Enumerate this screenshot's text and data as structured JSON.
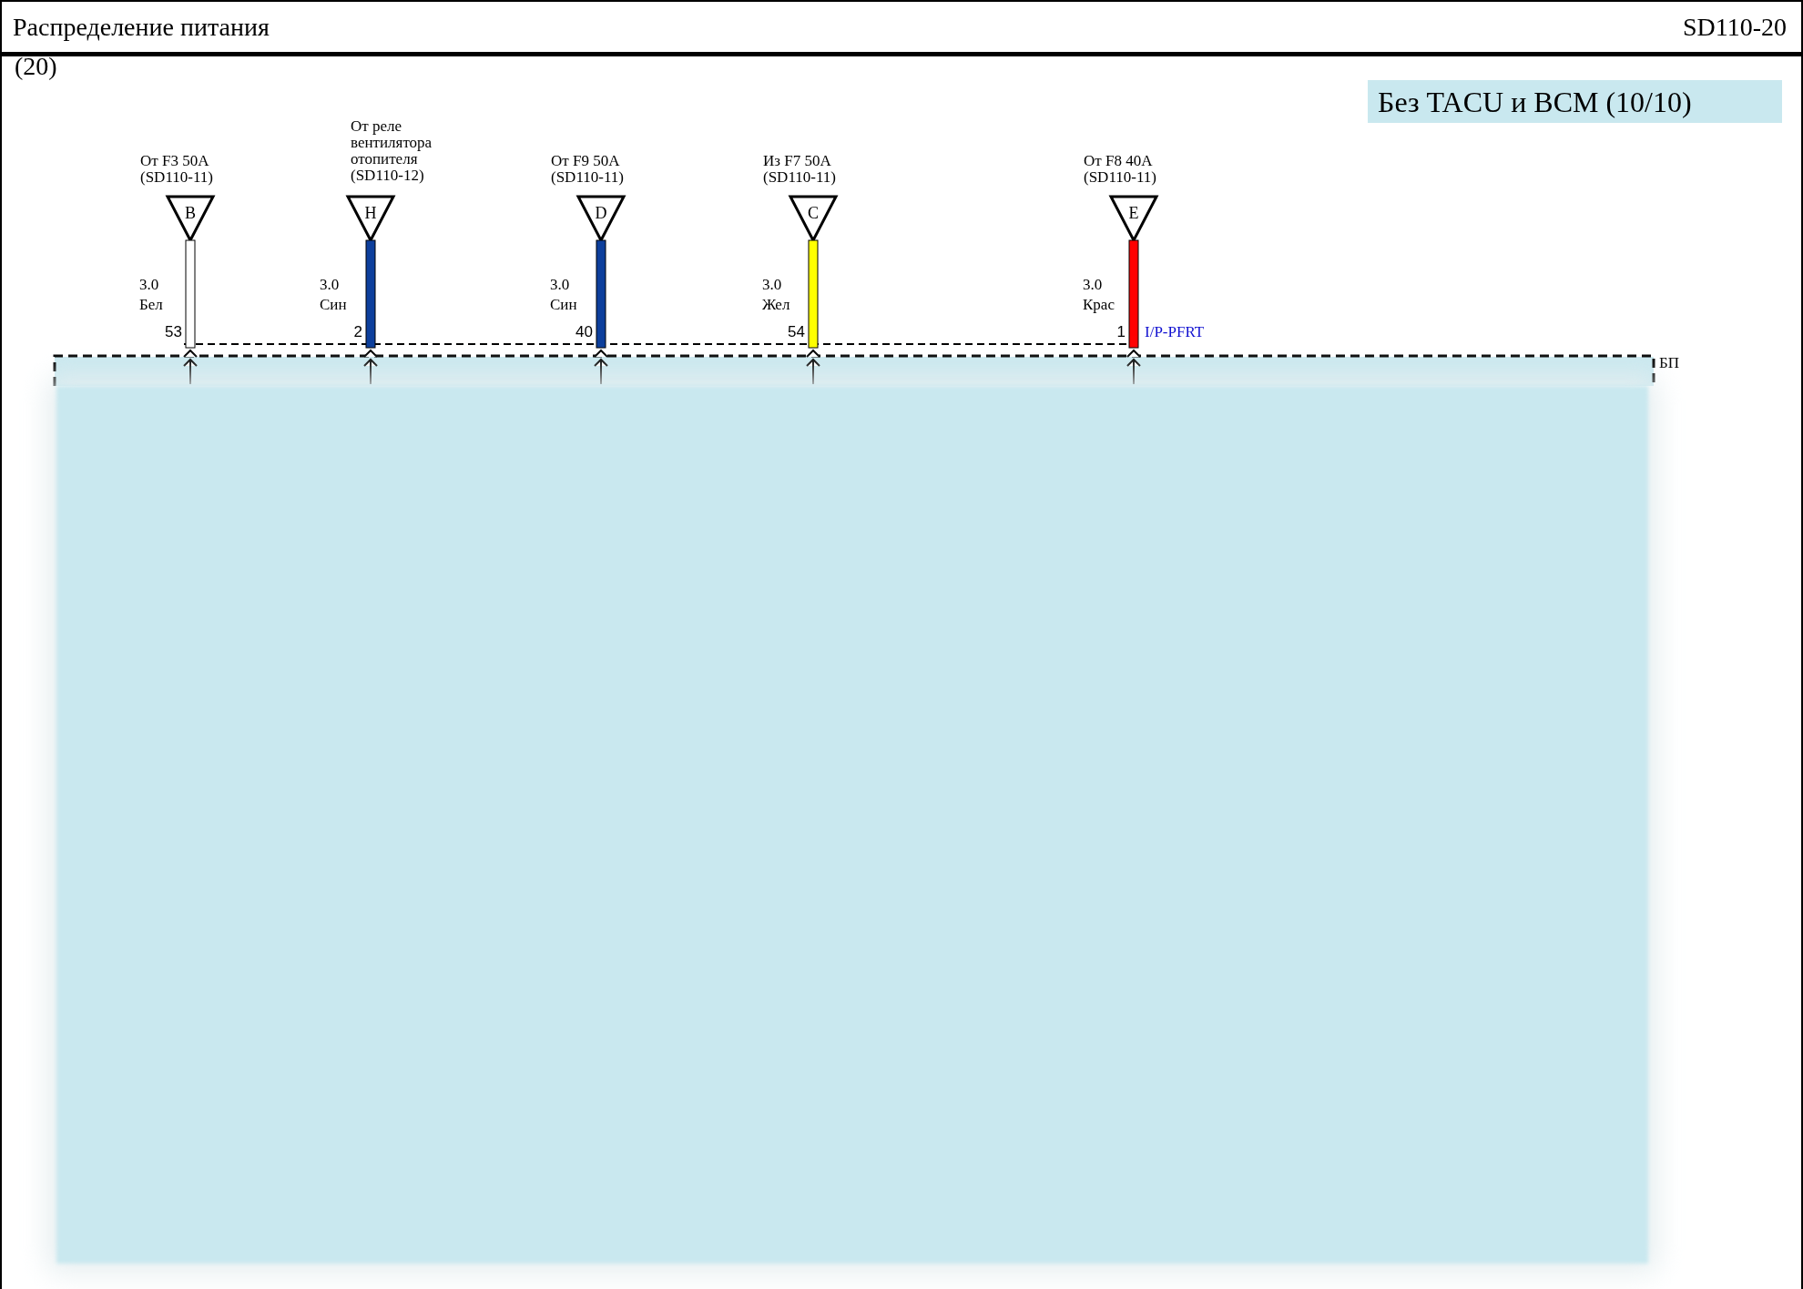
{
  "header": {
    "title": "Распределение питания",
    "page_code": "SD110-20",
    "subtitle": "(20)"
  },
  "banner": "Без TACU и BCM (10/10)",
  "connectors": [
    {
      "source": [
        "От F3 50A",
        "(SD110-11)"
      ],
      "letter": "B",
      "gauge": "3.0",
      "wire_color": "Бел",
      "pin": "53",
      "color": "#ffffff"
    },
    {
      "source": [
        "От реле",
        "вентилятора",
        "отопителя",
        "(SD110-12)"
      ],
      "letter": "H",
      "gauge": "3.0",
      "wire_color": "Син",
      "pin": "2",
      "color": "#0d3f9c"
    },
    {
      "source": [
        "От F9 50A",
        "(SD110-11)"
      ],
      "letter": "D",
      "gauge": "3.0",
      "wire_color": "Син",
      "pin": "40",
      "color": "#0d3f9c"
    },
    {
      "source": [
        "Из F7 50A",
        "(SD110-11)"
      ],
      "letter": "C",
      "gauge": "3.0",
      "wire_color": "Жел",
      "pin": "54",
      "color": "#ffff00"
    },
    {
      "source": [
        "От F8 40A",
        "(SD110-11)"
      ],
      "letter": "E",
      "gauge": "3.0",
      "wire_color": "Крас",
      "pin": "1",
      "color": "#ff0000",
      "connector_label": "I/P-PFRT"
    }
  ],
  "junction_box_label": "БП"
}
